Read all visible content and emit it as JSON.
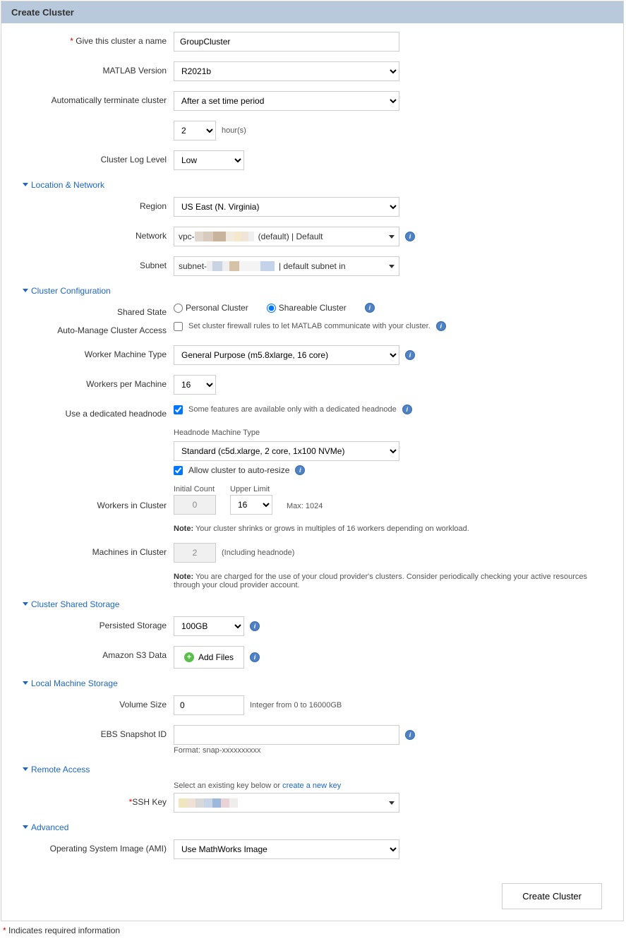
{
  "header": {
    "title": "Create Cluster"
  },
  "form": {
    "name_label": "Give this cluster a name",
    "name_value": "GroupCluster",
    "matlab_label": "MATLAB Version",
    "matlab_value": "R2021b",
    "terminate_label": "Automatically terminate cluster",
    "terminate_value": "After a set time period",
    "terminate_hours": "2",
    "terminate_hours_suffix": "hour(s)",
    "log_label": "Cluster Log Level",
    "log_value": "Low"
  },
  "sections": {
    "location": "Location & Network",
    "cluster": "Cluster Configuration",
    "storage": "Cluster Shared Storage",
    "local": "Local Machine Storage",
    "remote": "Remote Access",
    "advanced": "Advanced"
  },
  "location": {
    "region_label": "Region",
    "region_value": "US East (N. Virginia)",
    "network_label": "Network",
    "network_prefix": "vpc-",
    "network_suffix": "(default) | Default",
    "subnet_label": "Subnet",
    "subnet_prefix": "subnet-",
    "subnet_suffix": "| default subnet in"
  },
  "cluster": {
    "shared_state_label": "Shared State",
    "radio_personal": "Personal Cluster",
    "radio_shareable": "Shareable Cluster",
    "auto_manage_label": "Auto-Manage Cluster Access",
    "auto_manage_text": "Set cluster firewall rules to let MATLAB communicate with your cluster.",
    "worker_type_label": "Worker Machine Type",
    "worker_type_value": "General Purpose (m5.8xlarge, 16 core)",
    "workers_per_label": "Workers per Machine",
    "workers_per_value": "16",
    "dedicated_label": "Use a dedicated headnode",
    "dedicated_text": "Some features are available only with a dedicated headnode",
    "headnode_type_label": "Headnode Machine Type",
    "headnode_type_value": "Standard (c5d.xlarge, 2 core, 1x100 NVMe)",
    "autoresize_text": "Allow cluster to auto-resize",
    "workers_cluster_label": "Workers in Cluster",
    "initial_count_label": "Initial Count",
    "initial_count_value": "0",
    "upper_limit_label": "Upper Limit",
    "upper_limit_value": "16",
    "max_text": "Max: 1024",
    "note1_prefix": "Note:",
    "note1": " Your cluster shrinks or grows in multiples of 16 workers depending on workload.",
    "machines_label": "Machines in Cluster",
    "machines_value": "2",
    "machines_hint": "(Including headnode)",
    "note2_prefix": "Note:",
    "note2": " You are charged for the use of your cloud provider's clusters. Consider periodically checking your active resources through your cloud provider account."
  },
  "storage": {
    "persisted_label": "Persisted Storage",
    "persisted_value": "100GB",
    "s3_label": "Amazon S3 Data",
    "add_files": "Add Files"
  },
  "local": {
    "volume_label": "Volume Size",
    "volume_value": "0",
    "volume_hint": "Integer from 0 to 16000GB",
    "ebs_label": "EBS Snapshot ID",
    "ebs_value": "",
    "ebs_hint": "Format: snap-xxxxxxxxxx"
  },
  "remote": {
    "ssh_label": "SSH Key",
    "ssh_hint_prefix": "Select an existing key below or ",
    "ssh_link": "create a new key"
  },
  "advanced": {
    "ami_label": "Operating System Image (AMI)",
    "ami_value": "Use MathWorks Image"
  },
  "footer": {
    "submit": "Create Cluster",
    "req_note": " Indicates required information"
  }
}
